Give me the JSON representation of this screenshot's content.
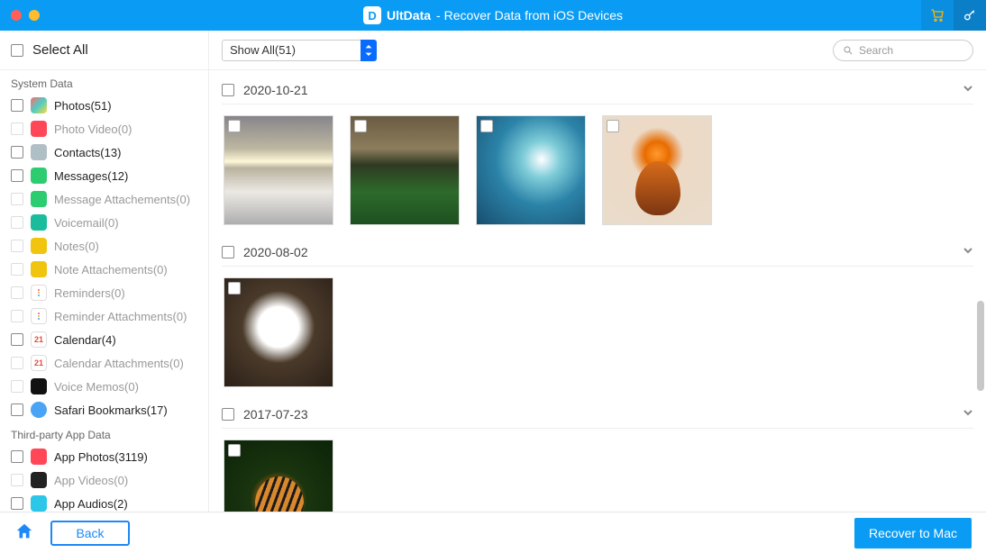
{
  "header": {
    "app_name": "UltData",
    "subtitle": " - Recover Data from iOS Devices"
  },
  "sidebar": {
    "select_all": "Select All",
    "sections": {
      "system": "System Data",
      "third_party": "Third-party App Data"
    },
    "items": [
      {
        "label": "Photos(51)",
        "enabled": true,
        "icon": "photos"
      },
      {
        "label": "Photo Video(0)",
        "enabled": false,
        "icon": "photovideo"
      },
      {
        "label": "Contacts(13)",
        "enabled": true,
        "icon": "contacts"
      },
      {
        "label": "Messages(12)",
        "enabled": true,
        "icon": "messages"
      },
      {
        "label": "Message Attachements(0)",
        "enabled": false,
        "icon": "msgatt"
      },
      {
        "label": "Voicemail(0)",
        "enabled": false,
        "icon": "voicemail"
      },
      {
        "label": "Notes(0)",
        "enabled": false,
        "icon": "notes"
      },
      {
        "label": "Note Attachements(0)",
        "enabled": false,
        "icon": "noteatt"
      },
      {
        "label": "Reminders(0)",
        "enabled": false,
        "icon": "reminders"
      },
      {
        "label": "Reminder Attachments(0)",
        "enabled": false,
        "icon": "reminders"
      },
      {
        "label": "Calendar(4)",
        "enabled": true,
        "icon": "calendar"
      },
      {
        "label": "Calendar Attachments(0)",
        "enabled": false,
        "icon": "calendar"
      },
      {
        "label": "Voice Memos(0)",
        "enabled": false,
        "icon": "voicememo"
      },
      {
        "label": "Safari Bookmarks(17)",
        "enabled": true,
        "icon": "safari"
      }
    ],
    "third_party_items": [
      {
        "label": "App Photos(3119)",
        "enabled": true,
        "icon": "appphoto"
      },
      {
        "label": "App Videos(0)",
        "enabled": false,
        "icon": "appvideo"
      },
      {
        "label": "App Audios(2)",
        "enabled": true,
        "icon": "appaudio"
      }
    ]
  },
  "toolbar": {
    "filter_label": "Show All(51)",
    "search_placeholder": "Search"
  },
  "groups": [
    {
      "date": "2020-10-21",
      "thumbs": [
        "sunclouds",
        "field",
        "wave",
        "hummingbird"
      ]
    },
    {
      "date": "2020-08-02",
      "thumbs": [
        "dandelion"
      ]
    },
    {
      "date": "2017-07-23",
      "thumbs": [
        "tiger"
      ]
    }
  ],
  "footer": {
    "back": "Back",
    "recover": "Recover to Mac"
  }
}
